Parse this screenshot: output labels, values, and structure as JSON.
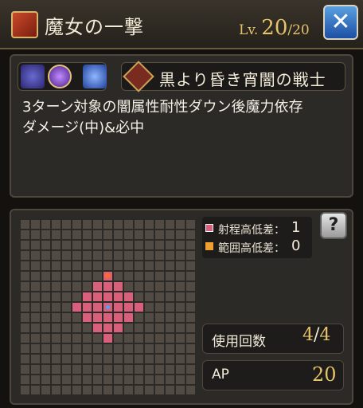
{
  "header": {
    "skill_name": "魔女の一撃",
    "level_label": "Lv.",
    "level_current": "20",
    "level_max": "/20",
    "close_glyph": "✕"
  },
  "panel": {
    "class_name": "黒より昏き宵闇の戦士",
    "description_line1": "3ターン対象の闇属性耐性ダウン後魔力依存",
    "description_line2": "ダメージ(中)&必中",
    "element_icons": [
      "dark-mage-icon",
      "dark-orb-icon",
      "moon-icon"
    ],
    "class_icon": "class-emblem-icon"
  },
  "range": {
    "legend_range_label": "射程高低差：",
    "legend_range_value": "1",
    "legend_area_label": "範囲高低差：",
    "legend_area_value": "0",
    "help_glyph": "?"
  },
  "stats": {
    "uses_label": "使用回数",
    "uses_current": "4",
    "uses_sep": "/",
    "uses_max": "4",
    "ap_label": "AP",
    "ap_value": "20"
  },
  "colors": {
    "gold": "#e6c36b",
    "range_cell": "#d9607a",
    "area_marker": "#f0a030",
    "center_marker": "#4aa3ff"
  }
}
